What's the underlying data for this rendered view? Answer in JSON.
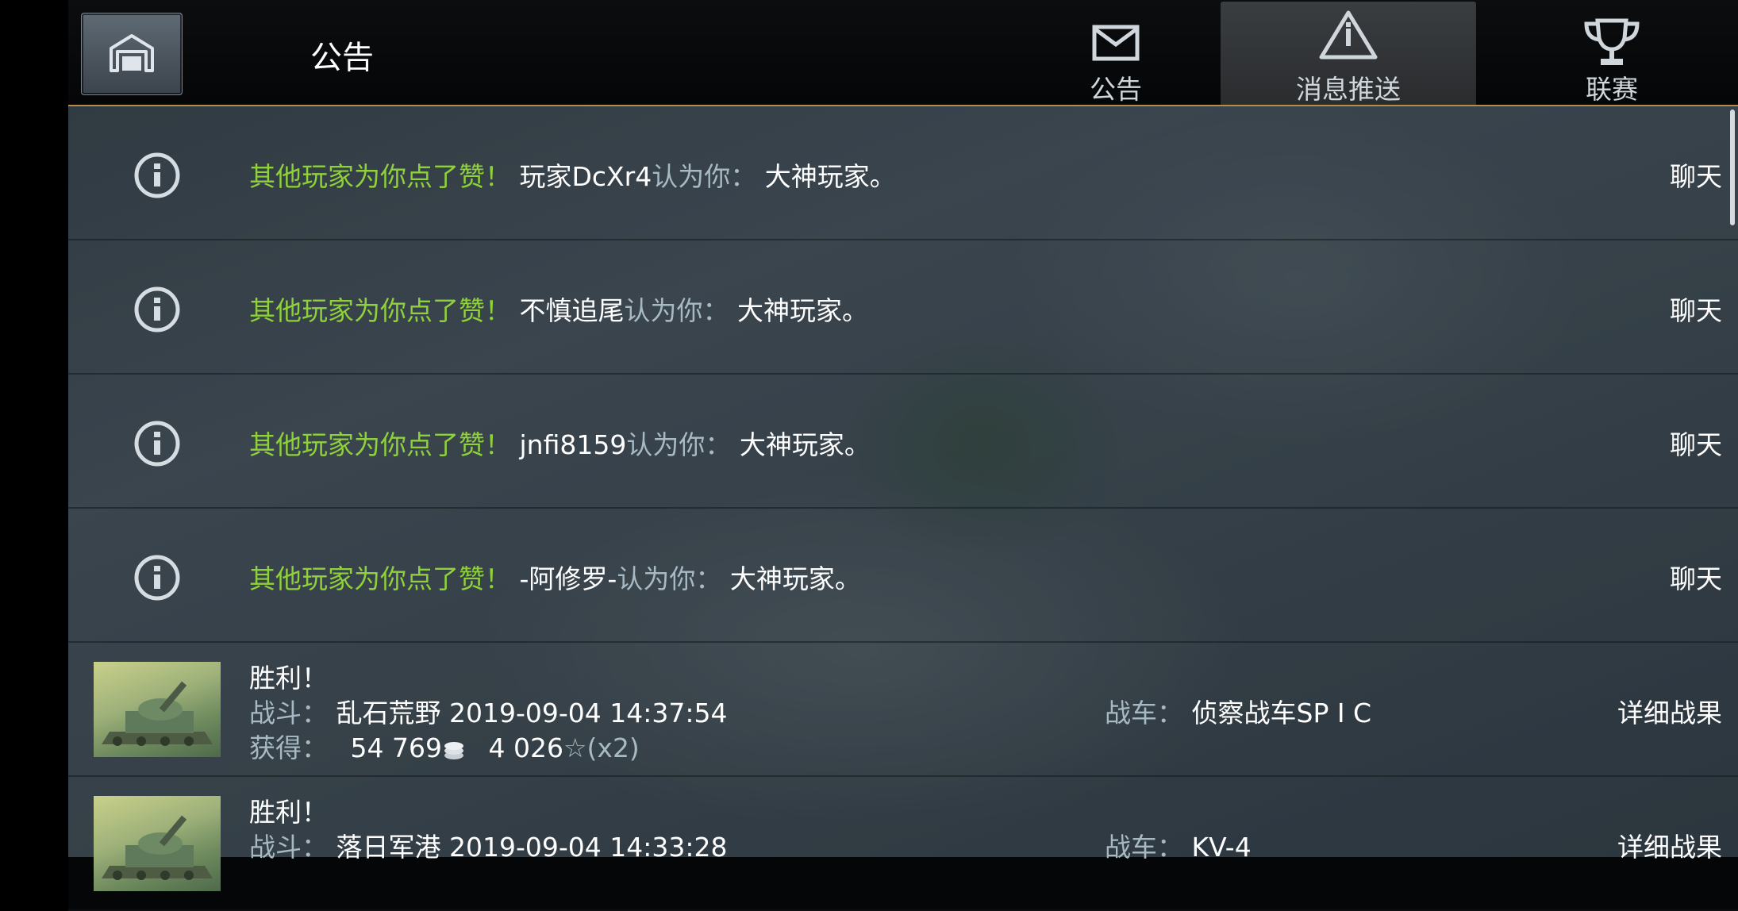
{
  "header": {
    "title": "公告",
    "tabs": [
      {
        "label": "公告",
        "icon": "mail-icon",
        "active": false
      },
      {
        "label": "消息推送",
        "icon": "warning-icon",
        "active": true
      },
      {
        "label": "联赛",
        "icon": "trophy-icon",
        "active": false
      }
    ]
  },
  "notifications": [
    {
      "prefix": "其他玩家为你点了赞！",
      "player": "玩家DcXr4",
      "mid": "认为你：",
      "suffix": "大神玩家。",
      "action": "聊天"
    },
    {
      "prefix": "其他玩家为你点了赞！",
      "player": "不慎追尾",
      "mid": "认为你：",
      "suffix": "大神玩家。",
      "action": "聊天"
    },
    {
      "prefix": "其他玩家为你点了赞！",
      "player": "jnfi8159",
      "mid": "认为你：",
      "suffix": "大神玩家。",
      "action": "聊天"
    },
    {
      "prefix": "其他玩家为你点了赞！",
      "player": "-阿修罗-",
      "mid": "认为你：",
      "suffix": "大神玩家。",
      "action": "聊天"
    }
  ],
  "battles": [
    {
      "result": "胜利！",
      "battle_label": "战斗：",
      "battle_value": "乱石荒野 2019-09-04 14:37:54",
      "earn_label": "获得：",
      "credits": "54 769",
      "xp": "4 026",
      "xp_multiplier": "☆(x2)",
      "tank_label": "战车：",
      "tank_value": "侦察战车SP I C",
      "action": "详细战果"
    },
    {
      "result": "胜利！",
      "battle_label": "战斗：",
      "battle_value": "落日军港 2019-09-04 14:33:28",
      "tank_label": "战车：",
      "tank_value": "KV-4",
      "action": "详细战果"
    }
  ],
  "colors": {
    "highlight_green": "#8fd13b",
    "label_grey": "#a7bac4",
    "header_border": "#b98b4a"
  }
}
